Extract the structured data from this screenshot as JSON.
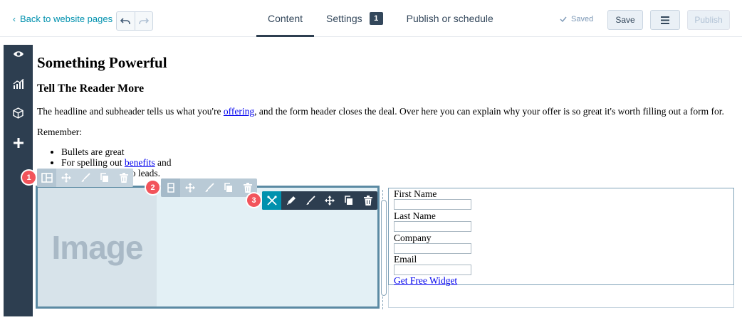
{
  "header": {
    "back_label": "Back to website pages",
    "tabs": [
      {
        "label": "Content"
      },
      {
        "label": "Settings",
        "badge": "1"
      },
      {
        "label": "Publish or schedule"
      }
    ],
    "saved_label": "Saved",
    "save_label": "Save",
    "publish_label": "Publish"
  },
  "sidebar": {
    "icons": [
      "eye-icon",
      "analytics-icon",
      "module-box-icon",
      "plus-icon"
    ]
  },
  "page": {
    "headline": "Something Powerful",
    "subheadline": "Tell The Reader More",
    "para_before": "The headline and subheader tells us what you're ",
    "para_link": "offering",
    "para_after": ", and the form header closes the deal. Over here you can explain why your offer is so great it's worth filling out a form for.",
    "remember": "Remember:",
    "bullet1": "Bullets are great",
    "bullet2_before": "For spelling out ",
    "bullet2_link": "benefits",
    "bullet2_after": " and",
    "bullet3_tail": "to leads.",
    "image_placeholder": "Image"
  },
  "form": {
    "fields": [
      {
        "label": "First Name"
      },
      {
        "label": "Last Name"
      },
      {
        "label": "Company"
      },
      {
        "label": "Email"
      }
    ],
    "submit_link": "Get Free Widget"
  },
  "toolbars": {
    "markers": [
      "1",
      "2",
      "3"
    ]
  },
  "colors": {
    "accent": "#0091ae",
    "rail": "#2d3e50",
    "marker": "#f2545b",
    "selection": "#5b8aa3"
  }
}
